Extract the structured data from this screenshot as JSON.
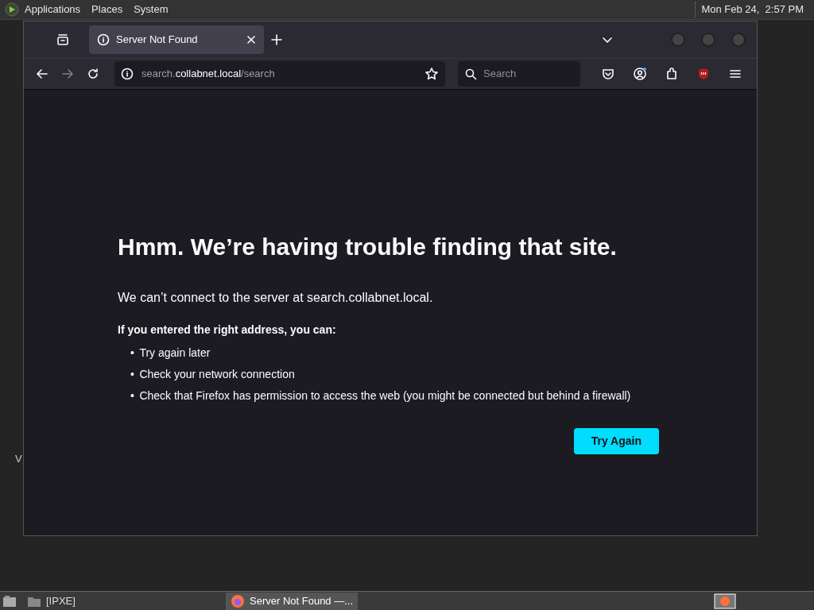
{
  "top_panel": {
    "menus": [
      "Applications",
      "Places",
      "System"
    ],
    "clock": "Mon Feb 24,  2:57 PM"
  },
  "desktop": {
    "label": "V"
  },
  "browser": {
    "tabs": [
      {
        "title": "Server Not Found",
        "selected": true
      }
    ],
    "nav": {
      "forward_disabled": true
    },
    "address": {
      "prefix": "search.",
      "domain": "collabnet.local",
      "path": "/search"
    },
    "search": {
      "placeholder": "Search"
    },
    "page": {
      "heading": "Hmm. We’re having trouble finding that site.",
      "message": "We can’t connect to the server at search.collabnet.local.",
      "advice_title": "If you entered the right address, you can:",
      "tips": [
        {
          "bullet": "•",
          "text": "Try again later"
        },
        {
          "bullet": "•",
          "text": "Check your network connection"
        },
        {
          "bullet": "•",
          "text": "Check that Firefox has permission to access the web (you might be connected but behind a firewall)"
        }
      ],
      "button": "Try Again"
    }
  },
  "taskbar": {
    "items": [
      {
        "label": "[IPXE]",
        "kind": "folder",
        "selected": false
      },
      {
        "label": "Server Not Found —...",
        "kind": "browser",
        "selected": true
      }
    ]
  }
}
